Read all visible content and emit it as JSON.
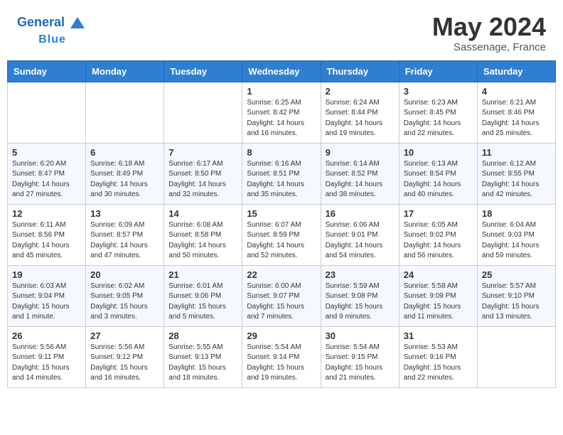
{
  "header": {
    "logo_line1": "General",
    "logo_line2": "Blue",
    "month": "May 2024",
    "location": "Sassenage, France"
  },
  "days_of_week": [
    "Sunday",
    "Monday",
    "Tuesday",
    "Wednesday",
    "Thursday",
    "Friday",
    "Saturday"
  ],
  "weeks": [
    [
      {
        "day": "",
        "info": ""
      },
      {
        "day": "",
        "info": ""
      },
      {
        "day": "",
        "info": ""
      },
      {
        "day": "1",
        "info": "Sunrise: 6:25 AM\nSunset: 8:42 PM\nDaylight: 14 hours\nand 16 minutes."
      },
      {
        "day": "2",
        "info": "Sunrise: 6:24 AM\nSunset: 8:44 PM\nDaylight: 14 hours\nand 19 minutes."
      },
      {
        "day": "3",
        "info": "Sunrise: 6:23 AM\nSunset: 8:45 PM\nDaylight: 14 hours\nand 22 minutes."
      },
      {
        "day": "4",
        "info": "Sunrise: 6:21 AM\nSunset: 8:46 PM\nDaylight: 14 hours\nand 25 minutes."
      }
    ],
    [
      {
        "day": "5",
        "info": "Sunrise: 6:20 AM\nSunset: 8:47 PM\nDaylight: 14 hours\nand 27 minutes."
      },
      {
        "day": "6",
        "info": "Sunrise: 6:18 AM\nSunset: 8:49 PM\nDaylight: 14 hours\nand 30 minutes."
      },
      {
        "day": "7",
        "info": "Sunrise: 6:17 AM\nSunset: 8:50 PM\nDaylight: 14 hours\nand 32 minutes."
      },
      {
        "day": "8",
        "info": "Sunrise: 6:16 AM\nSunset: 8:51 PM\nDaylight: 14 hours\nand 35 minutes."
      },
      {
        "day": "9",
        "info": "Sunrise: 6:14 AM\nSunset: 8:52 PM\nDaylight: 14 hours\nand 38 minutes."
      },
      {
        "day": "10",
        "info": "Sunrise: 6:13 AM\nSunset: 8:54 PM\nDaylight: 14 hours\nand 40 minutes."
      },
      {
        "day": "11",
        "info": "Sunrise: 6:12 AM\nSunset: 8:55 PM\nDaylight: 14 hours\nand 42 minutes."
      }
    ],
    [
      {
        "day": "12",
        "info": "Sunrise: 6:11 AM\nSunset: 8:56 PM\nDaylight: 14 hours\nand 45 minutes."
      },
      {
        "day": "13",
        "info": "Sunrise: 6:09 AM\nSunset: 8:57 PM\nDaylight: 14 hours\nand 47 minutes."
      },
      {
        "day": "14",
        "info": "Sunrise: 6:08 AM\nSunset: 8:58 PM\nDaylight: 14 hours\nand 50 minutes."
      },
      {
        "day": "15",
        "info": "Sunrise: 6:07 AM\nSunset: 8:59 PM\nDaylight: 14 hours\nand 52 minutes."
      },
      {
        "day": "16",
        "info": "Sunrise: 6:06 AM\nSunset: 9:01 PM\nDaylight: 14 hours\nand 54 minutes."
      },
      {
        "day": "17",
        "info": "Sunrise: 6:05 AM\nSunset: 9:02 PM\nDaylight: 14 hours\nand 56 minutes."
      },
      {
        "day": "18",
        "info": "Sunrise: 6:04 AM\nSunset: 9:03 PM\nDaylight: 14 hours\nand 59 minutes."
      }
    ],
    [
      {
        "day": "19",
        "info": "Sunrise: 6:03 AM\nSunset: 9:04 PM\nDaylight: 15 hours\nand 1 minute."
      },
      {
        "day": "20",
        "info": "Sunrise: 6:02 AM\nSunset: 9:05 PM\nDaylight: 15 hours\nand 3 minutes."
      },
      {
        "day": "21",
        "info": "Sunrise: 6:01 AM\nSunset: 9:06 PM\nDaylight: 15 hours\nand 5 minutes."
      },
      {
        "day": "22",
        "info": "Sunrise: 6:00 AM\nSunset: 9:07 PM\nDaylight: 15 hours\nand 7 minutes."
      },
      {
        "day": "23",
        "info": "Sunrise: 5:59 AM\nSunset: 9:08 PM\nDaylight: 15 hours\nand 9 minutes."
      },
      {
        "day": "24",
        "info": "Sunrise: 5:58 AM\nSunset: 9:09 PM\nDaylight: 15 hours\nand 11 minutes."
      },
      {
        "day": "25",
        "info": "Sunrise: 5:57 AM\nSunset: 9:10 PM\nDaylight: 15 hours\nand 13 minutes."
      }
    ],
    [
      {
        "day": "26",
        "info": "Sunrise: 5:56 AM\nSunset: 9:11 PM\nDaylight: 15 hours\nand 14 minutes."
      },
      {
        "day": "27",
        "info": "Sunrise: 5:56 AM\nSunset: 9:12 PM\nDaylight: 15 hours\nand 16 minutes."
      },
      {
        "day": "28",
        "info": "Sunrise: 5:55 AM\nSunset: 9:13 PM\nDaylight: 15 hours\nand 18 minutes."
      },
      {
        "day": "29",
        "info": "Sunrise: 5:54 AM\nSunset: 9:14 PM\nDaylight: 15 hours\nand 19 minutes."
      },
      {
        "day": "30",
        "info": "Sunrise: 5:54 AM\nSunset: 9:15 PM\nDaylight: 15 hours\nand 21 minutes."
      },
      {
        "day": "31",
        "info": "Sunrise: 5:53 AM\nSunset: 9:16 PM\nDaylight: 15 hours\nand 22 minutes."
      },
      {
        "day": "",
        "info": ""
      }
    ]
  ]
}
